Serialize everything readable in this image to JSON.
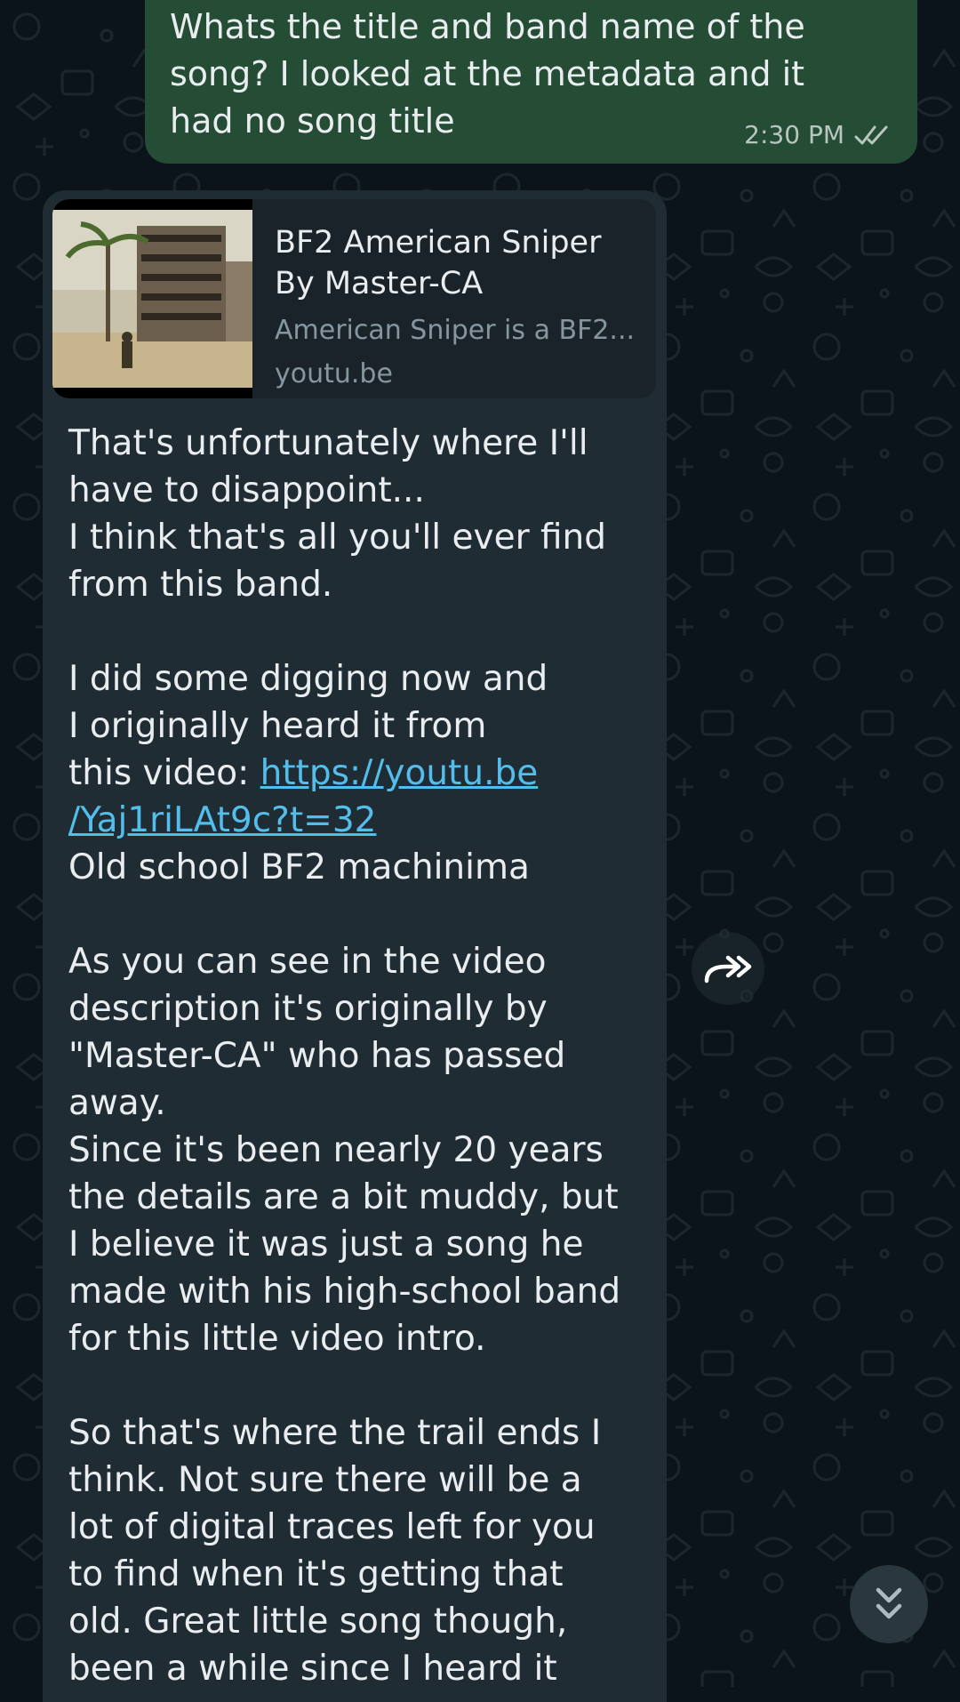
{
  "outgoing": {
    "text": "Whats the title and band name of the\nsong? I looked at the metadata and it\nhad no song title",
    "time": "2:30 PM",
    "status_icon": "double-check-icon"
  },
  "incoming": {
    "link_preview": {
      "title": "BF2 American Sniper\nBy Master-CA",
      "description": "American Sniper is a BF2...",
      "domain": "youtu.be",
      "thumbnail_icon": "video-thumbnail"
    },
    "paragraphs": {
      "p1": "That's unfortunately where I'll\nhave to disappoint...\nI think that's all you'll ever find\nfrom this band.",
      "p2_before_link": "I did some digging now and\nI originally heard it from\nthis video: ",
      "p2_link": "https://youtu.be\n/Yaj1riLAt9c?t=32",
      "p2_after_link": "Old school BF2 machinima",
      "p3": "As you can see in the video\ndescription it's originally by\n\"Master-CA\" who has passed\naway.\nSince it's been nearly 20 years\nthe details are a bit muddy, but\nI believe it was just a song he\nmade with his high-school band\nfor this little video intro.",
      "p4": "So that's where the trail ends I\nthink. Not sure there will be a\nlot of digital traces left for you\nto find when it's getting that\nold. Great little song though,\nbeen a while since I heard it"
    }
  },
  "buttons": {
    "forward_icon": "forward-icon",
    "scroll_down_icon": "double-chevron-down-icon"
  },
  "colors": {
    "background": "#0b141a",
    "outgoing_bubble": "#254d36",
    "incoming_bubble": "#202c33",
    "link": "#53bdeb",
    "secondary_text": "#8696a0"
  }
}
